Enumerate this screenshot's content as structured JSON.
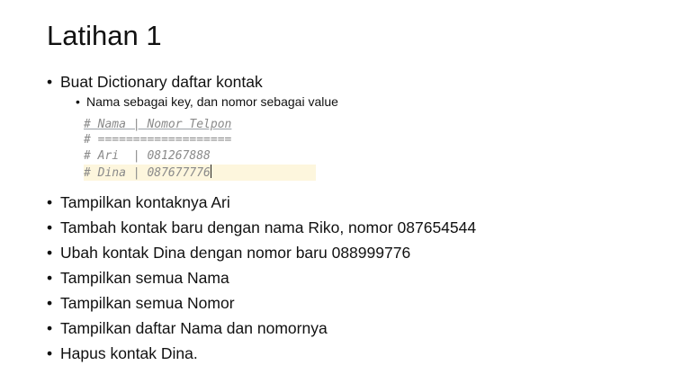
{
  "title": "Latihan 1",
  "bullet_symbol": "•",
  "main_item": {
    "text": "Buat Dictionary daftar kontak",
    "sub_item": "Nama sebagai key, dan nomor sebagai value"
  },
  "code_lines": [
    "# Nama | Nomor Telpon",
    "# ===================",
    "# Ari  | 081267888",
    "# Dina | 087677776"
  ],
  "tasks": [
    "Tampilkan kontaknya Ari",
    "Tambah kontak baru dengan nama Riko, nomor 087654544",
    "Ubah kontak Dina dengan nomor baru 088999776",
    "Tampilkan semua Nama",
    "Tampilkan semua Nomor",
    "Tampilkan daftar Nama dan nomornya",
    "Hapus kontak Dina."
  ],
  "colors": {
    "code_text": "#8a8a8a",
    "code_highlight": "#fdf6dd"
  }
}
